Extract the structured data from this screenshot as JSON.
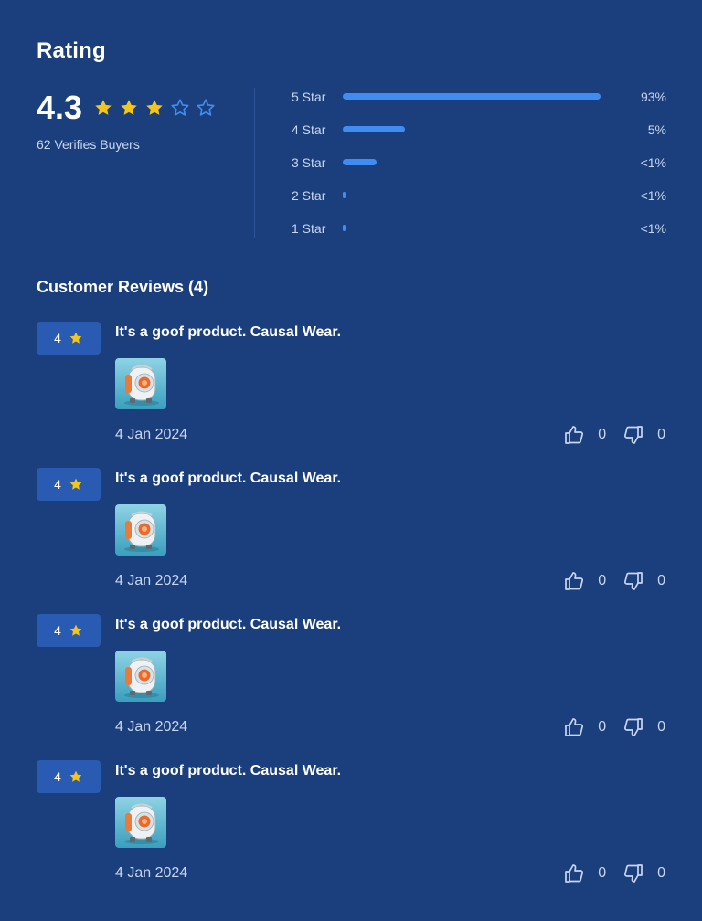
{
  "rating": {
    "title": "Rating",
    "score": "4.3",
    "stars_filled": 3,
    "stars_total": 5,
    "buyers_text": "62 Verifies Buyers",
    "distribution": [
      {
        "label": "5 Star",
        "percent_text": "93%",
        "fill": 1.0
      },
      {
        "label": "4 Star",
        "percent_text": "5%",
        "fill": 0.24
      },
      {
        "label": "3 Star",
        "percent_text": "<1%",
        "fill": 0.13
      },
      {
        "label": "2 Star",
        "percent_text": "<1%",
        "fill": 0.01
      },
      {
        "label": "1 Star",
        "percent_text": "<1%",
        "fill": 0.01
      }
    ]
  },
  "reviews": {
    "title": "Customer Reviews (4)",
    "items": [
      {
        "rating": "4",
        "title": "It's a goof product. Causal Wear.",
        "date": "4 Jan 2024",
        "likes": "0",
        "dislikes": "0"
      },
      {
        "rating": "4",
        "title": "It's a goof product. Causal Wear.",
        "date": "4 Jan 2024",
        "likes": "0",
        "dislikes": "0"
      },
      {
        "rating": "4",
        "title": "It's a goof product. Causal Wear.",
        "date": "4 Jan 2024",
        "likes": "0",
        "dislikes": "0"
      },
      {
        "rating": "4",
        "title": "It's a goof product. Causal Wear.",
        "date": "4 Jan 2024",
        "likes": "0",
        "dislikes": "0"
      }
    ]
  },
  "icons": {
    "filled_star": "star-filled-icon",
    "empty_star": "star-outline-icon",
    "like": "thumbs-up-icon",
    "dislike": "thumbs-down-icon"
  },
  "colors": {
    "background": "#1b3f7c",
    "star_filled": "#f5c518",
    "star_empty": "#3f8df2",
    "bar": "#3f8df2",
    "badge": "#2a5bb2"
  }
}
